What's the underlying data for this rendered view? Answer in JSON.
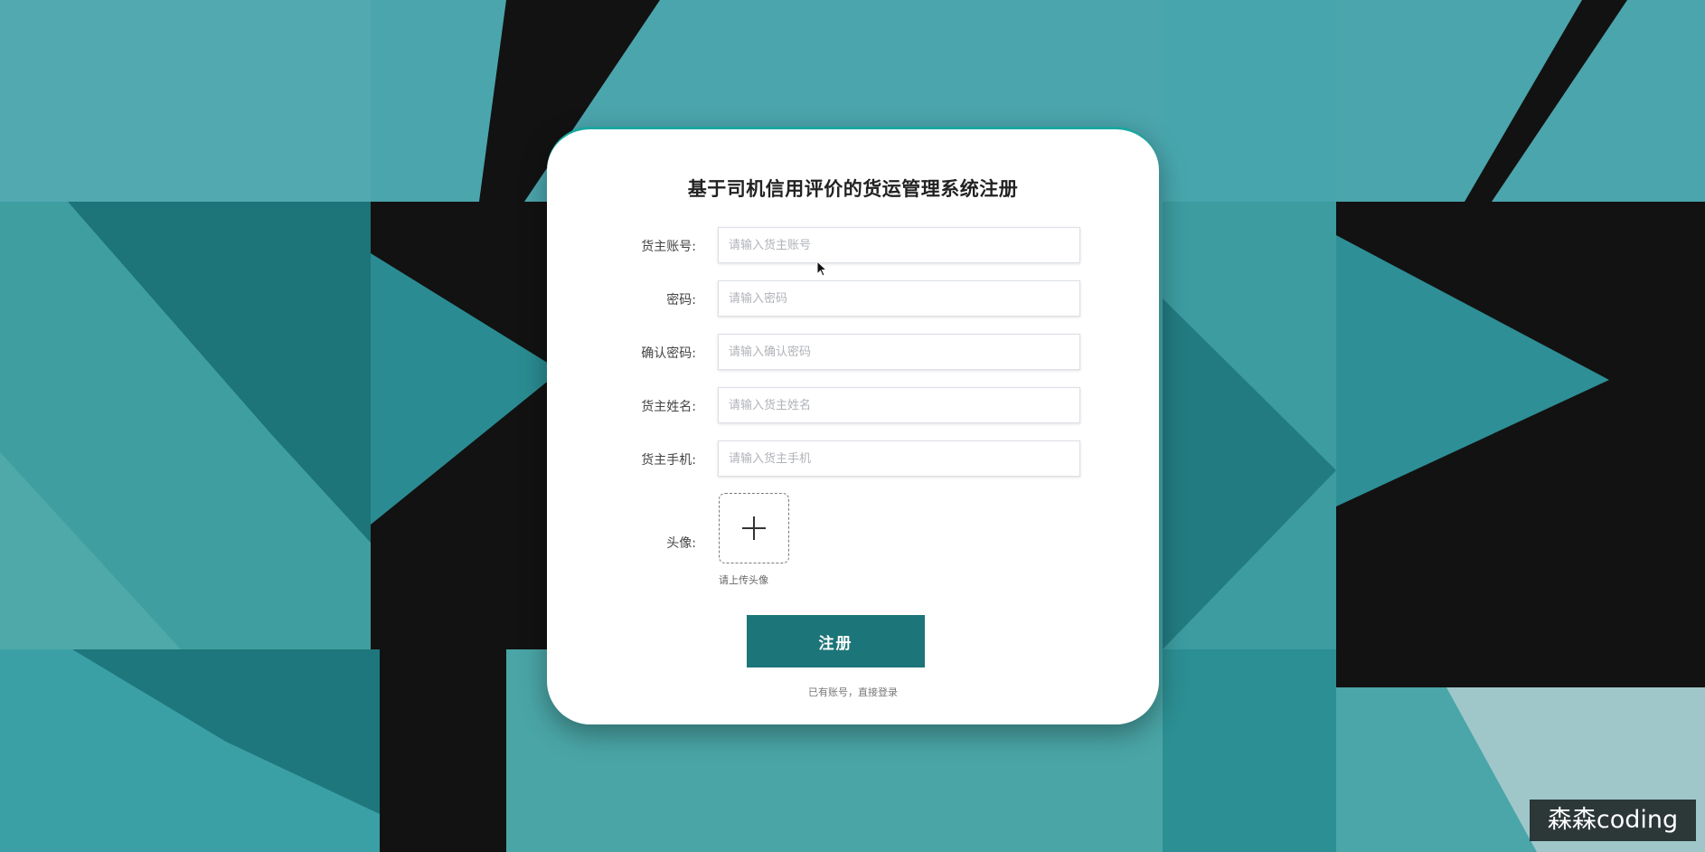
{
  "form": {
    "title": "基于司机信用评价的货运管理系统注册",
    "fields": [
      {
        "label": "货主账号:",
        "placeholder": "请输入货主账号"
      },
      {
        "label": "密码:",
        "placeholder": "请输入密码"
      },
      {
        "label": "确认密码:",
        "placeholder": "请输入确认密码"
      },
      {
        "label": "货主姓名:",
        "placeholder": "请输入货主姓名"
      },
      {
        "label": "货主手机:",
        "placeholder": "请输入货主手机"
      }
    ],
    "avatar": {
      "label": "头像:",
      "hint": "请上传头像",
      "icon": "plus-icon"
    },
    "submit_label": "注册",
    "login_link": "已有账号，直接登录"
  },
  "watermark": "森森coding",
  "colors": {
    "accent": "#1c7578",
    "background_teal": "#4aa6a6",
    "background_dark": "#121212"
  }
}
